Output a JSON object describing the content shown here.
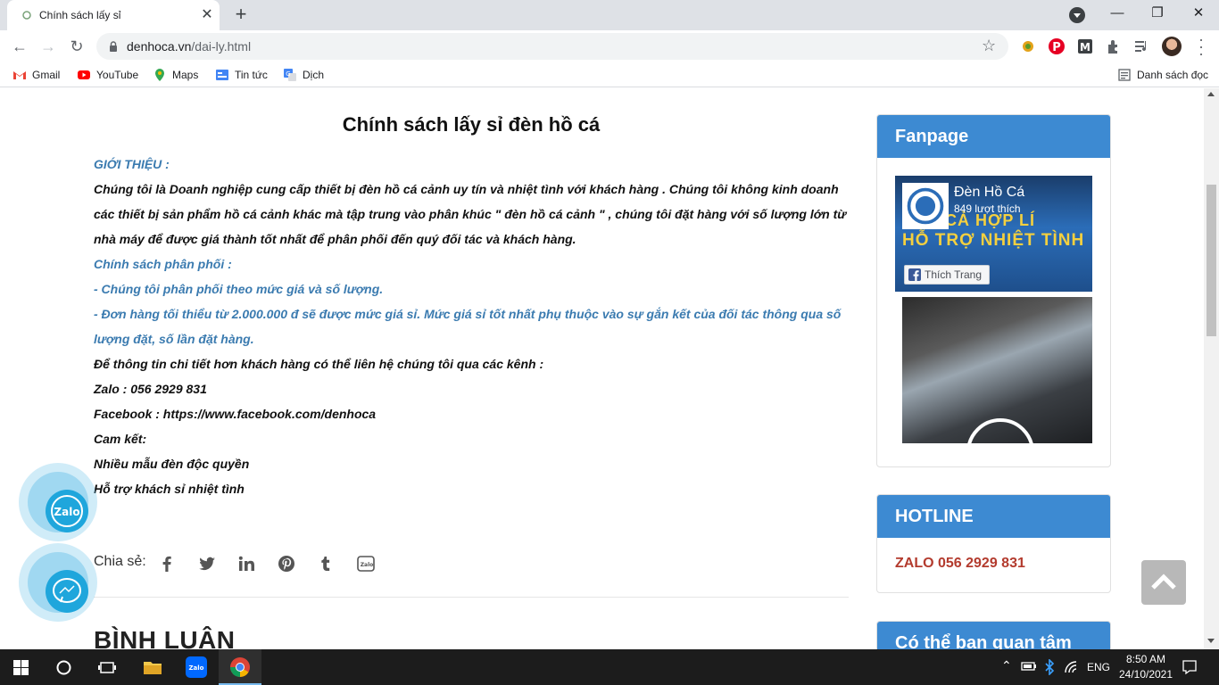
{
  "browser": {
    "tab_title": "Chính sách lấy sỉ",
    "url_host": "denhoca.vn",
    "url_path": "/dai-ly.html",
    "reading_list": "Danh sách đọc",
    "bookmarks": [
      "Gmail",
      "YouTube",
      "Maps",
      "Tin tức",
      "Dịch"
    ]
  },
  "article": {
    "title": "Chính sách lấy sỉ đèn hồ cá",
    "intro_heading": "GIỚI THIỆU :",
    "intro_line1": "Chúng tôi là Doanh nghiệp cung cấp thiết bị đèn hồ cá cảnh uy tín và nhiệt tình với khách hàng . Chúng tôi không kinh doanh",
    "intro_line2": "các thiết bị sản phẩm hồ cá cảnh khác mà tập trung vào phân khúc \" đèn hồ cá cảnh \" , chúng tôi đặt hàng với số lượng lớn từ",
    "intro_line3": "nhà máy để được giá thành tốt nhất để phân phối đến quý đối tác và khách hàng.",
    "policy_heading": "Chính sách phân phối :",
    "policy_1": "- Chúng tôi phân phối theo mức giá và số lượng.",
    "policy_2_line1": "- Đơn hàng tối thiểu từ 2.000.000 đ sẽ được mức giá sỉ. Mức giá sỉ tốt nhất phụ thuộc vào sự gắn kết của đối tác thông qua số",
    "policy_2_line2": "lượng đặt, số lần đặt hàng.",
    "contact_intro": "Để thông tin chi tiết hơn khách hàng có thể liên hệ chúng tôi qua các kênh :",
    "zalo": "Zalo : 056 2929 831",
    "facebook": "Facebook : https://www.facebook.com/denhoca",
    "commit_heading": "Cam kết:",
    "commit_1": "Nhiều mẫu đèn độc quyền",
    "commit_2": "Hỗ trợ khách sỉ nhiệt tình",
    "share_label": "Chia sẻ:",
    "comments_heading": "BÌNH LUẬN"
  },
  "sidebar": {
    "fanpage_title": "Fanpage",
    "fb_page_name": "Đèn Hồ Cá",
    "fb_likes": "849 lượt thích",
    "fb_like_button": "Thích Trang",
    "fb_cover_line1": "IÁ CẢ HỢP LÍ",
    "fb_cover_line2": "HỖ TRỢ NHIỆT TÌNH",
    "hotline_title": "HOTLINE",
    "hotline_value": "ZALO 056 2929 831",
    "next_widget_title": "Có thể bạn quan tâm"
  },
  "taskbar": {
    "lang": "ENG",
    "time": "8:50 AM",
    "date": "24/10/2021"
  },
  "colors": {
    "accent_blue": "#3d8ad2",
    "policy_text": "#3b7bb0",
    "hotline_red": "#b33b2e"
  }
}
